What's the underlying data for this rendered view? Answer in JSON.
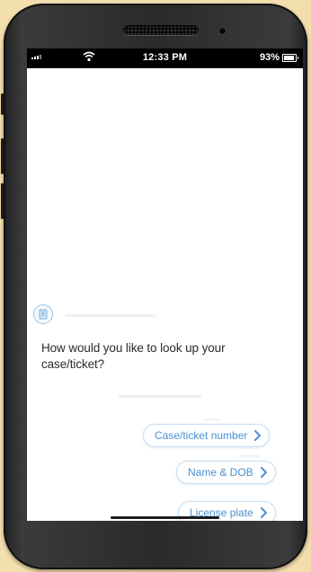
{
  "status_bar": {
    "time": "12:33 PM",
    "battery": "93%"
  },
  "chat": {
    "bot_message": "How would you like to look up your case/ticket?",
    "options": [
      {
        "label": "Case/ticket number",
        "icon": "chevron-right-icon"
      },
      {
        "label": "Name & DOB",
        "icon": "chevron-right-icon"
      },
      {
        "label": "License plate",
        "icon": "chevron-right-icon"
      }
    ]
  },
  "colors": {
    "background": "#f3dfae",
    "accent": "#4a90d2",
    "option_border": "#c7ddf2",
    "phone_body": "#2a2a2a"
  }
}
